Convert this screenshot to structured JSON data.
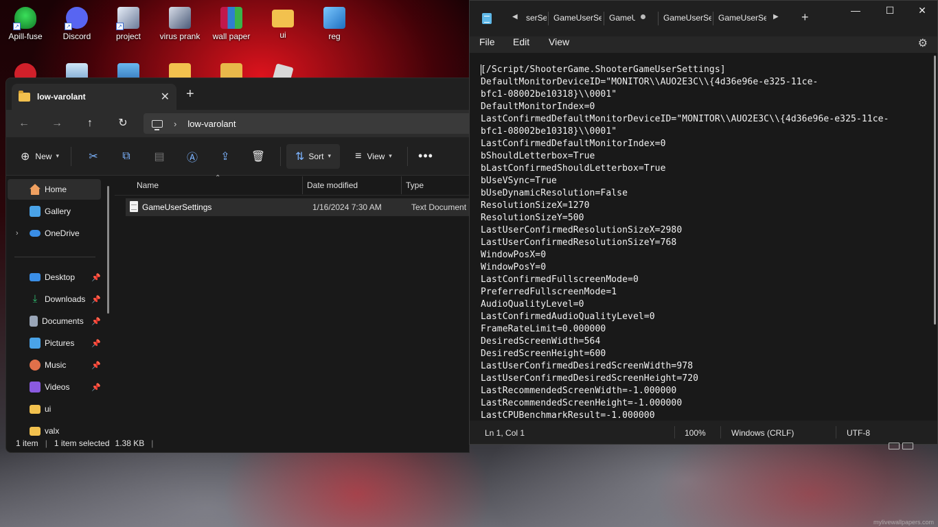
{
  "desktop": {
    "icons": [
      {
        "label": "Apill-fuse",
        "icon": "green-sprite-icon",
        "color": "#2db34a"
      },
      {
        "label": "Discord",
        "icon": "discord-icon",
        "color": "#5865f2"
      },
      {
        "label": "project",
        "icon": "project-app-icon",
        "color": "#9aa6b8"
      },
      {
        "label": "virus prank",
        "icon": "virus-prank-icon",
        "color": "#7a8aa8"
      },
      {
        "label": "wall paper",
        "icon": "winrar-icon",
        "color": "#c2184b"
      },
      {
        "label": "ui",
        "icon": "folder-icon",
        "color": "#f2c14e"
      },
      {
        "label": "reg",
        "icon": "registry-cubes-icon",
        "color": "#3aa0e8"
      }
    ],
    "second_row_icons": [
      "red-app-icon",
      "recycle-bin-icon",
      "network-icon",
      "folder-icon",
      "folder-icon",
      "roblox-icon"
    ],
    "watermark": "mylivewallpapers.com"
  },
  "explorer": {
    "tab_title": "low-varolant",
    "address_segment": "low-varolant",
    "toolbar": {
      "new_label": "New",
      "sort_label": "Sort",
      "view_label": "View"
    },
    "sidebar": [
      {
        "label": "Home",
        "icon": "home-icon",
        "color": "#f0a060"
      },
      {
        "label": "Gallery",
        "icon": "gallery-icon",
        "color": "#4aa3e8"
      },
      {
        "label": "OneDrive",
        "icon": "onedrive-icon",
        "color": "#3a8ee6"
      },
      {
        "label": "Desktop",
        "icon": "desktop-icon",
        "color": "#3a8ee6"
      },
      {
        "label": "Downloads",
        "icon": "downloads-icon",
        "color": "#2fbf71"
      },
      {
        "label": "Documents",
        "icon": "documents-icon",
        "color": "#9aa6b8"
      },
      {
        "label": "Pictures",
        "icon": "pictures-icon",
        "color": "#4aa3e8"
      },
      {
        "label": "Music",
        "icon": "music-icon",
        "color": "#e0704a"
      },
      {
        "label": "Videos",
        "icon": "videos-icon",
        "color": "#8a5ae0"
      },
      {
        "label": "ui",
        "icon": "folder-icon",
        "color": "#f2c14e"
      },
      {
        "label": "valx",
        "icon": "folder-icon",
        "color": "#f2c14e"
      }
    ],
    "columns": {
      "name": "Name",
      "date": "Date modified",
      "type": "Type"
    },
    "files": [
      {
        "name": "GameUserSettings",
        "date": "1/16/2024 7:30 AM",
        "type": "Text Document"
      }
    ],
    "status": {
      "count": "1 item",
      "selected": "1 item selected",
      "size": "1.38 KB"
    }
  },
  "notepad": {
    "tabs": [
      "serSe",
      "GameUserSe",
      "GameU",
      "GameUserSe",
      "GameUserSe"
    ],
    "menu": {
      "file": "File",
      "edit": "Edit",
      "view": "View"
    },
    "content": "[/Script/ShooterGame.ShooterGameUserSettings]\nDefaultMonitorDeviceID=\"MONITOR\\\\AUO2E3C\\\\{4d36e96e-e325-11ce-\nbfc1-08002be10318}\\\\0001\"\nDefaultMonitorIndex=0\nLastConfirmedDefaultMonitorDeviceID=\"MONITOR\\\\AUO2E3C\\\\{4d36e96e-e325-11ce-\nbfc1-08002be10318}\\\\0001\"\nLastConfirmedDefaultMonitorIndex=0\nbShouldLetterbox=True\nbLastConfirmedShouldLetterbox=True\nbUseVSync=True\nbUseDynamicResolution=False\nResolutionSizeX=1270\nResolutionSizeY=500\nLastUserConfirmedResolutionSizeX=2980\nLastUserConfirmedResolutionSizeY=768\nWindowPosX=0\nWindowPosY=0\nLastConfirmedFullscreenMode=0\nPreferredFullscreenMode=1\nAudioQualityLevel=0\nLastConfirmedAudioQualityLevel=0\nFrameRateLimit=0.000000\nDesiredScreenWidth=564\nDesiredScreenHeight=600\nLastUserConfirmedDesiredScreenWidth=978\nLastUserConfirmedDesiredScreenHeight=720\nLastRecommendedScreenWidth=-1.000000\nLastRecommendedScreenHeight=-1.000000\nLastCPUBenchmarkResult=-1.000000",
    "status": {
      "position": "Ln 1, Col 1",
      "zoom": "100%",
      "line_endings": "Windows (CRLF)",
      "encoding": "UTF-8"
    }
  }
}
